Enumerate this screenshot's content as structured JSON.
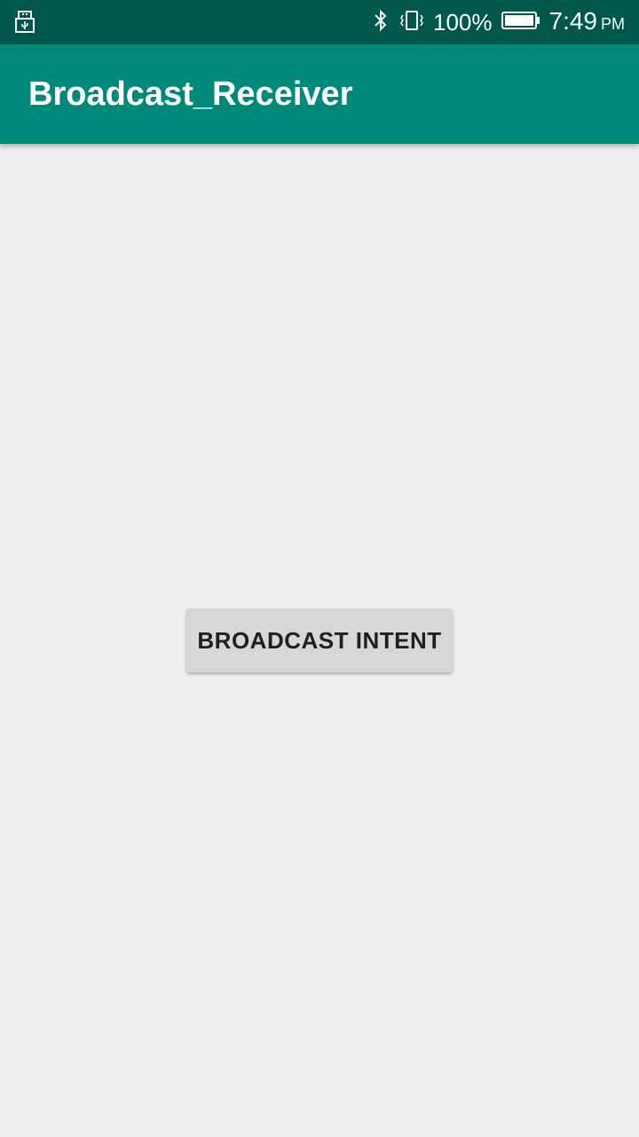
{
  "status_bar": {
    "left_icon": "usb-debug-icon",
    "bluetooth_icon": "bluetooth-icon",
    "vibrate_icon": "vibrate-icon",
    "battery_percent": "100%",
    "battery_icon": "battery-full-icon",
    "time": "7:49",
    "ampm": "PM"
  },
  "app_bar": {
    "title": "Broadcast_Receiver"
  },
  "main": {
    "broadcast_button_label": "BROADCAST INTENT"
  },
  "colors": {
    "status_bar": "#00584c",
    "app_bar": "#00897b",
    "background": "#eeeeee",
    "button": "#d6d7d7"
  }
}
